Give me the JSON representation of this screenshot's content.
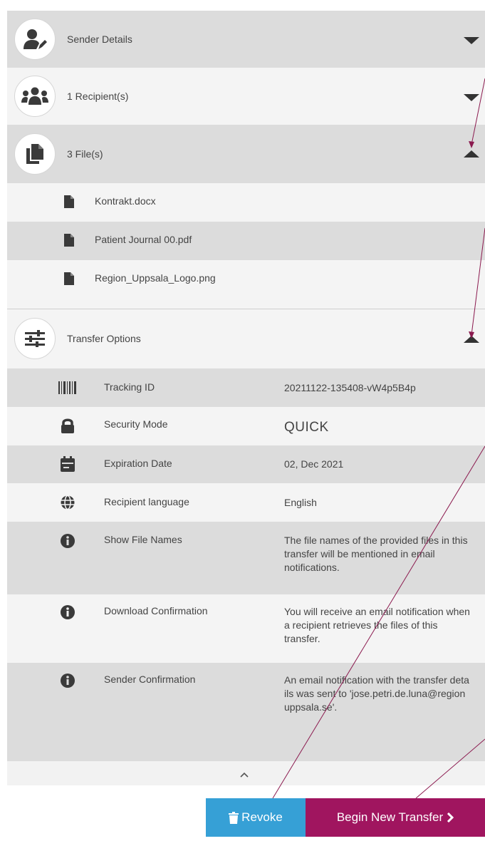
{
  "sections": {
    "sender": {
      "label": "Sender Details"
    },
    "recipients": {
      "label": "1 Recipient(s)"
    },
    "files": {
      "label": "3 File(s)"
    },
    "options": {
      "label": "Transfer Options"
    }
  },
  "files": [
    "Kontrakt.docx",
    "Patient Journal 00.pdf",
    "Region_Uppsala_Logo.png"
  ],
  "options": [
    {
      "label": "Tracking ID",
      "value": "20211122-135408-vW4p5B4p",
      "icon": "barcode-icon"
    },
    {
      "label": "Security Mode",
      "value": "QUICK",
      "icon": "lock-icon"
    },
    {
      "label": "Expiration Date",
      "value": "02, Dec 2021",
      "icon": "calendar-icon"
    },
    {
      "label": "Recipient language",
      "value": "English",
      "icon": "globe-icon"
    },
    {
      "label": "Show File Names",
      "value": "The file names of the provided files in this transfer will be mentioned in email notifications.",
      "icon": "info-icon"
    },
    {
      "label": "Download Confirmation",
      "value": "You will receive an email notification when a recipient retrieves the files of this transfer.",
      "icon": "info-icon"
    },
    {
      "label": "Sender Confirmation",
      "value": "An email notification with the transfer details was sent to 'jose.petri.de.luna@regionuppsala.se'.",
      "icon": "info-icon"
    }
  ],
  "buttons": {
    "revoke": "Revoke",
    "new_transfer": "Begin New Transfer"
  },
  "colors": {
    "revoke": "#36a0d6",
    "new_transfer": "#a0155f",
    "gray_row": "#dcdcdc",
    "light_row": "#f4f4f4"
  }
}
